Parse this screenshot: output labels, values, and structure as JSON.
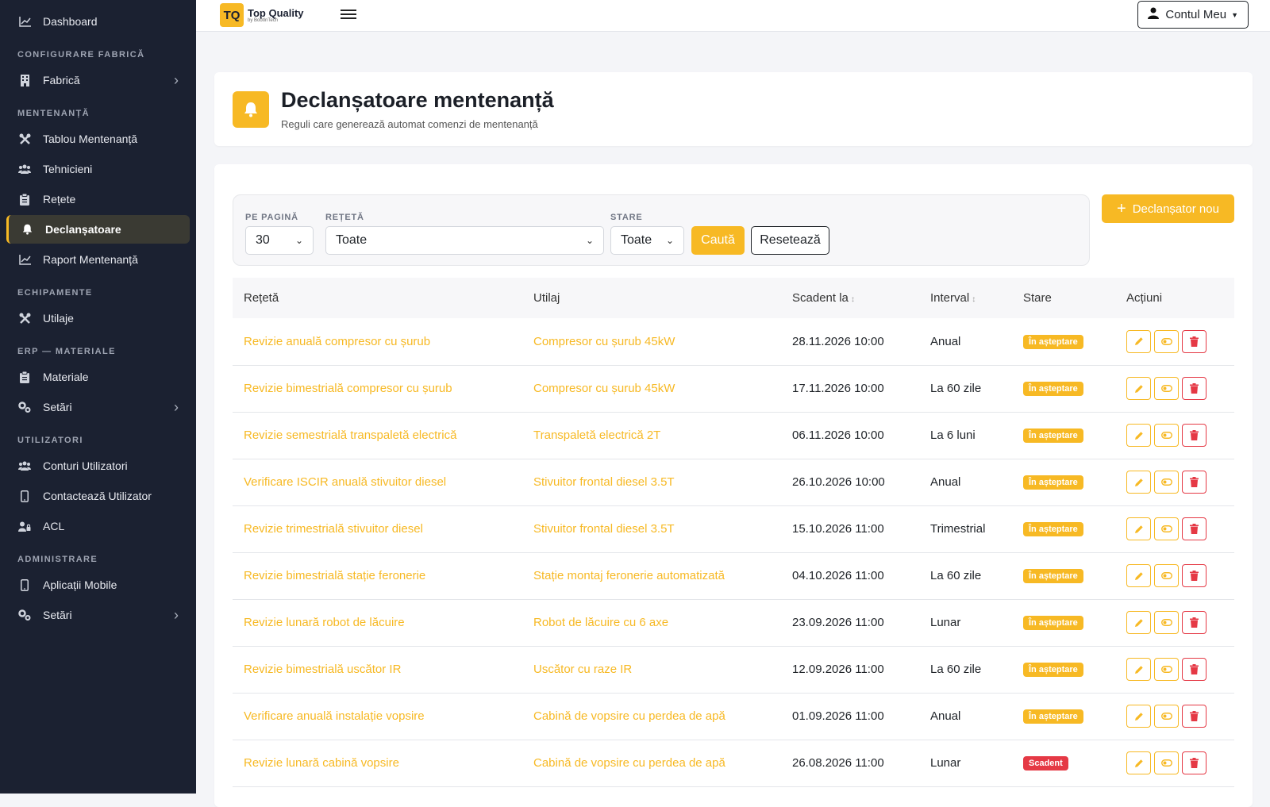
{
  "sidebar": {
    "items": [
      {
        "type": "item",
        "label": "Dashboard",
        "icon": "chart-line-icon"
      },
      {
        "type": "section",
        "label": "CONFIGURARE FABRICĂ"
      },
      {
        "type": "item",
        "label": "Fabrică",
        "icon": "building-icon",
        "chevron": true
      },
      {
        "type": "section",
        "label": "MENTENANȚĂ"
      },
      {
        "type": "item",
        "label": "Tablou Mentenanță",
        "icon": "tools-icon"
      },
      {
        "type": "item",
        "label": "Tehnicieni",
        "icon": "users-icon"
      },
      {
        "type": "item",
        "label": "Rețete",
        "icon": "clipboard-icon"
      },
      {
        "type": "item",
        "label": "Declanșatoare",
        "icon": "bell-icon",
        "active": true
      },
      {
        "type": "item",
        "label": "Raport Mentenanță",
        "icon": "chart-line-icon"
      },
      {
        "type": "section",
        "label": "ECHIPAMENTE"
      },
      {
        "type": "item",
        "label": "Utilaje",
        "icon": "tools-icon"
      },
      {
        "type": "section",
        "label": "ERP — MATERIALE"
      },
      {
        "type": "item",
        "label": "Materiale",
        "icon": "clipboard-icon"
      },
      {
        "type": "item",
        "label": "Setări",
        "icon": "cogs-icon",
        "chevron": true
      },
      {
        "type": "section",
        "label": "UTILIZATORI"
      },
      {
        "type": "item",
        "label": "Conturi Utilizatori",
        "icon": "users-icon"
      },
      {
        "type": "item",
        "label": "Contactează Utilizator",
        "icon": "mobile-icon"
      },
      {
        "type": "item",
        "label": "ACL",
        "icon": "user-lock-icon"
      },
      {
        "type": "section",
        "label": "ADMINISTRARE"
      },
      {
        "type": "item",
        "label": "Aplicații Mobile",
        "icon": "mobile-icon"
      },
      {
        "type": "item",
        "label": "Setări",
        "icon": "cogs-icon",
        "chevron": true
      }
    ]
  },
  "topbar": {
    "logo_mark": "TQ",
    "logo_title": "Top Quality",
    "logo_sub": "by BootInTech",
    "account_label": "Contul Meu"
  },
  "header": {
    "title": "Declanșatoare mentenanță",
    "subtitle": "Reguli care generează automat comenzi de mentenanță"
  },
  "filters": {
    "per_page_label": "PE PAGINĂ",
    "per_page_value": "30",
    "recipe_label": "REȚETĂ",
    "recipe_value": "Toate",
    "state_label": "STARE",
    "state_value": "Toate",
    "search_label": "Caută",
    "reset_label": "Resetează",
    "new_label": "Declanșator nou"
  },
  "table": {
    "columns": [
      "Rețetă",
      "Utilaj",
      "Scadent la",
      "Interval",
      "Stare",
      "Acțiuni"
    ],
    "sortable": [
      false,
      false,
      true,
      true,
      false,
      false
    ],
    "rows": [
      {
        "recipe": "Revizie anuală compresor cu șurub",
        "equipment": "Compresor cu șurub 45kW",
        "due": "28.11.2026 10:00",
        "interval": "Anual",
        "status": "În așteptare",
        "status_color": "#f7b924"
      },
      {
        "recipe": "Revizie bimestrială compresor cu șurub",
        "equipment": "Compresor cu șurub 45kW",
        "due": "17.11.2026 10:00",
        "interval": "La 60 zile",
        "status": "În așteptare",
        "status_color": "#f7b924"
      },
      {
        "recipe": "Revizie semestrială transpaletă electrică",
        "equipment": "Transpaletă electrică 2T",
        "due": "06.11.2026 10:00",
        "interval": "La 6 luni",
        "status": "În așteptare",
        "status_color": "#f7b924"
      },
      {
        "recipe": "Verificare ISCIR anuală stivuitor diesel",
        "equipment": "Stivuitor frontal diesel 3.5T",
        "due": "26.10.2026 10:00",
        "interval": "Anual",
        "status": "În așteptare",
        "status_color": "#f7b924"
      },
      {
        "recipe": "Revizie trimestrială stivuitor diesel",
        "equipment": "Stivuitor frontal diesel 3.5T",
        "due": "15.10.2026 11:00",
        "interval": "Trimestrial",
        "status": "În așteptare",
        "status_color": "#f7b924"
      },
      {
        "recipe": "Revizie bimestrială stație feronerie",
        "equipment": "Stație montaj feronerie automatizată",
        "due": "04.10.2026 11:00",
        "interval": "La 60 zile",
        "status": "În așteptare",
        "status_color": "#f7b924"
      },
      {
        "recipe": "Revizie lunară robot de lăcuire",
        "equipment": "Robot de lăcuire cu 6 axe",
        "due": "23.09.2026 11:00",
        "interval": "Lunar",
        "status": "În așteptare",
        "status_color": "#f7b924"
      },
      {
        "recipe": "Revizie bimestrială uscător IR",
        "equipment": "Uscător cu raze IR",
        "due": "12.09.2026 11:00",
        "interval": "La 60 zile",
        "status": "În așteptare",
        "status_color": "#f7b924"
      },
      {
        "recipe": "Verificare anuală instalație vopsire",
        "equipment": "Cabină de vopsire cu perdea de apă",
        "due": "01.09.2026 11:00",
        "interval": "Anual",
        "status": "În așteptare",
        "status_color": "#f7b924"
      },
      {
        "recipe": "Revizie lunară cabină vopsire",
        "equipment": "Cabină de vopsire cu perdea de apă",
        "due": "26.08.2026 11:00",
        "interval": "Lunar",
        "status": "Scadent",
        "status_color": "#e53945"
      }
    ]
  },
  "colors": {
    "accent": "#f7b924",
    "danger": "#e53945",
    "sidebar_bg": "#1b2131"
  }
}
